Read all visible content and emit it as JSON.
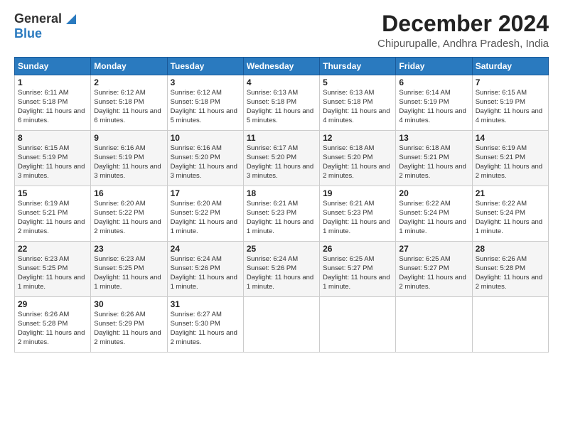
{
  "logo": {
    "line1": "General",
    "line2": "Blue"
  },
  "title": "December 2024",
  "subtitle": "Chipurupalle, Andhra Pradesh, India",
  "days_of_week": [
    "Sunday",
    "Monday",
    "Tuesday",
    "Wednesday",
    "Thursday",
    "Friday",
    "Saturday"
  ],
  "weeks": [
    [
      {
        "day": 1,
        "sunrise": "6:11 AM",
        "sunset": "5:18 PM",
        "daylight": "11 hours and 6 minutes."
      },
      {
        "day": 2,
        "sunrise": "6:12 AM",
        "sunset": "5:18 PM",
        "daylight": "11 hours and 6 minutes."
      },
      {
        "day": 3,
        "sunrise": "6:12 AM",
        "sunset": "5:18 PM",
        "daylight": "11 hours and 5 minutes."
      },
      {
        "day": 4,
        "sunrise": "6:13 AM",
        "sunset": "5:18 PM",
        "daylight": "11 hours and 5 minutes."
      },
      {
        "day": 5,
        "sunrise": "6:13 AM",
        "sunset": "5:18 PM",
        "daylight": "11 hours and 4 minutes."
      },
      {
        "day": 6,
        "sunrise": "6:14 AM",
        "sunset": "5:19 PM",
        "daylight": "11 hours and 4 minutes."
      },
      {
        "day": 7,
        "sunrise": "6:15 AM",
        "sunset": "5:19 PM",
        "daylight": "11 hours and 4 minutes."
      }
    ],
    [
      {
        "day": 8,
        "sunrise": "6:15 AM",
        "sunset": "5:19 PM",
        "daylight": "11 hours and 3 minutes."
      },
      {
        "day": 9,
        "sunrise": "6:16 AM",
        "sunset": "5:19 PM",
        "daylight": "11 hours and 3 minutes."
      },
      {
        "day": 10,
        "sunrise": "6:16 AM",
        "sunset": "5:20 PM",
        "daylight": "11 hours and 3 minutes."
      },
      {
        "day": 11,
        "sunrise": "6:17 AM",
        "sunset": "5:20 PM",
        "daylight": "11 hours and 3 minutes."
      },
      {
        "day": 12,
        "sunrise": "6:18 AM",
        "sunset": "5:20 PM",
        "daylight": "11 hours and 2 minutes."
      },
      {
        "day": 13,
        "sunrise": "6:18 AM",
        "sunset": "5:21 PM",
        "daylight": "11 hours and 2 minutes."
      },
      {
        "day": 14,
        "sunrise": "6:19 AM",
        "sunset": "5:21 PM",
        "daylight": "11 hours and 2 minutes."
      }
    ],
    [
      {
        "day": 15,
        "sunrise": "6:19 AM",
        "sunset": "5:21 PM",
        "daylight": "11 hours and 2 minutes."
      },
      {
        "day": 16,
        "sunrise": "6:20 AM",
        "sunset": "5:22 PM",
        "daylight": "11 hours and 2 minutes."
      },
      {
        "day": 17,
        "sunrise": "6:20 AM",
        "sunset": "5:22 PM",
        "daylight": "11 hours and 1 minute."
      },
      {
        "day": 18,
        "sunrise": "6:21 AM",
        "sunset": "5:23 PM",
        "daylight": "11 hours and 1 minute."
      },
      {
        "day": 19,
        "sunrise": "6:21 AM",
        "sunset": "5:23 PM",
        "daylight": "11 hours and 1 minute."
      },
      {
        "day": 20,
        "sunrise": "6:22 AM",
        "sunset": "5:24 PM",
        "daylight": "11 hours and 1 minute."
      },
      {
        "day": 21,
        "sunrise": "6:22 AM",
        "sunset": "5:24 PM",
        "daylight": "11 hours and 1 minute."
      }
    ],
    [
      {
        "day": 22,
        "sunrise": "6:23 AM",
        "sunset": "5:25 PM",
        "daylight": "11 hours and 1 minute."
      },
      {
        "day": 23,
        "sunrise": "6:23 AM",
        "sunset": "5:25 PM",
        "daylight": "11 hours and 1 minute."
      },
      {
        "day": 24,
        "sunrise": "6:24 AM",
        "sunset": "5:26 PM",
        "daylight": "11 hours and 1 minute."
      },
      {
        "day": 25,
        "sunrise": "6:24 AM",
        "sunset": "5:26 PM",
        "daylight": "11 hours and 1 minute."
      },
      {
        "day": 26,
        "sunrise": "6:25 AM",
        "sunset": "5:27 PM",
        "daylight": "11 hours and 1 minute."
      },
      {
        "day": 27,
        "sunrise": "6:25 AM",
        "sunset": "5:27 PM",
        "daylight": "11 hours and 2 minutes."
      },
      {
        "day": 28,
        "sunrise": "6:26 AM",
        "sunset": "5:28 PM",
        "daylight": "11 hours and 2 minutes."
      }
    ],
    [
      {
        "day": 29,
        "sunrise": "6:26 AM",
        "sunset": "5:28 PM",
        "daylight": "11 hours and 2 minutes."
      },
      {
        "day": 30,
        "sunrise": "6:26 AM",
        "sunset": "5:29 PM",
        "daylight": "11 hours and 2 minutes."
      },
      {
        "day": 31,
        "sunrise": "6:27 AM",
        "sunset": "5:30 PM",
        "daylight": "11 hours and 2 minutes."
      },
      null,
      null,
      null,
      null
    ]
  ]
}
